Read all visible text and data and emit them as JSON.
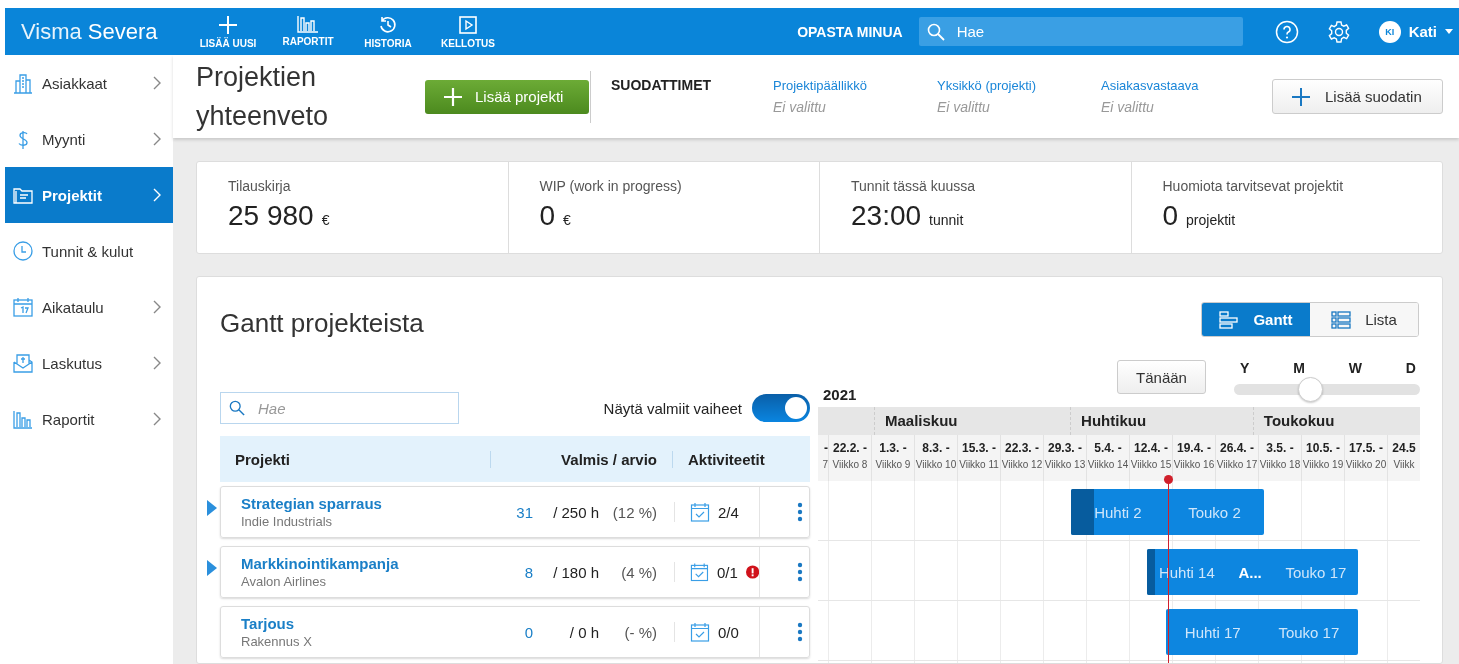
{
  "logo": {
    "light": "Visma",
    "bold": "Severa"
  },
  "topnav": [
    {
      "label": "LISÄÄ UUSI",
      "kind": "add"
    },
    {
      "label": "RAPORTIT",
      "kind": "reports"
    },
    {
      "label": "HISTORIA",
      "kind": "history"
    },
    {
      "label": "KELLOTUS",
      "kind": "timer"
    }
  ],
  "guide": "OPASTA MINUA",
  "search": {
    "placeholder": "Hae"
  },
  "user": {
    "initials": "KI",
    "name": "Kati"
  },
  "sidebar": {
    "items": [
      {
        "label": "Asiakkaat",
        "kind": "customers",
        "selected": false,
        "submenu": true
      },
      {
        "label": "Myynti",
        "kind": "sales",
        "selected": false,
        "submenu": true
      },
      {
        "label": "Projektit",
        "kind": "projects",
        "selected": true,
        "submenu": true
      },
      {
        "label": "Tunnit & kulut",
        "kind": "hours",
        "selected": false,
        "submenu": false
      },
      {
        "label": "Aikataulu",
        "kind": "schedule",
        "selected": false,
        "submenu": true
      },
      {
        "label": "Laskutus",
        "kind": "billing",
        "selected": false,
        "submenu": true
      },
      {
        "label": "Raportit",
        "kind": "reports",
        "selected": false,
        "submenu": true
      }
    ]
  },
  "page_title": "Projektien yhteenveto",
  "add_project": "Lisää projekti",
  "filters": {
    "title": "SUODATTIMET",
    "items": [
      {
        "label": "Projektipäällikkö",
        "value": "Ei valittu"
      },
      {
        "label": "Yksikkö (projekti)",
        "value": "Ei valittu"
      },
      {
        "label": "Asiakasvastaava",
        "value": "Ei valittu"
      }
    ],
    "add_button": "Lisää suodatin"
  },
  "summary": [
    {
      "label": "Tilauskirja",
      "value": "25 980",
      "unit": "€"
    },
    {
      "label": "WIP (work in progress)",
      "value": "0",
      "unit": "€"
    },
    {
      "label": "Tunnit tässä kuussa",
      "value": "23:00",
      "unit": "tunnit"
    },
    {
      "label": "Huomiota tarvitsevat projektit",
      "value": "0",
      "unit": "projektit"
    }
  ],
  "gantt": {
    "title": "Gantt projekteista",
    "views": [
      {
        "label": "Gantt",
        "kind": "gantt",
        "selected": true
      },
      {
        "label": "Lista",
        "kind": "list",
        "selected": false
      }
    ],
    "today_button": "Tänään",
    "zoom": {
      "labels": [
        "Y",
        "M",
        "W",
        "D"
      ],
      "level": 0.4
    },
    "search": {
      "placeholder": "Hae"
    },
    "show_completed": {
      "label": "Näytä valmiit vaiheet",
      "on": true
    },
    "columns": [
      "Projekti",
      "Valmis / arvio",
      "Aktiviteetit"
    ],
    "rows": [
      {
        "name": "Strategian sparraus",
        "customer": "Indie Industrials",
        "done": "31",
        "estimate": "/ 250 h",
        "percent": "(12 %)",
        "activities": "2/4",
        "alert": false,
        "expandable": true
      },
      {
        "name": "Markkinointikampanja",
        "customer": "Avalon Airlines",
        "done": "8",
        "estimate": "/ 180 h",
        "percent": "(4 %)",
        "activities": "0/1",
        "alert": true,
        "expandable": true
      },
      {
        "name": "Tarjous",
        "customer": "Rakennus X",
        "done": "0",
        "estimate": "/ 0 h",
        "percent": "(- %)",
        "activities": "0/0",
        "alert": false,
        "expandable": false
      }
    ],
    "timeline": {
      "year": "2021",
      "months": [
        "Maaliskuu",
        "Huhtikuu",
        "Toukokuu"
      ],
      "weeks": [
        {
          "date": "-",
          "week": "7"
        },
        {
          "date": "22.2. -",
          "week": "Viikko 8"
        },
        {
          "date": "1.3. -",
          "week": "Viikko 9"
        },
        {
          "date": "8.3. -",
          "week": "Viikko 10"
        },
        {
          "date": "15.3. -",
          "week": "Viikko 11"
        },
        {
          "date": "22.3. -",
          "week": "Viikko 12"
        },
        {
          "date": "29.3. -",
          "week": "Viikko 13"
        },
        {
          "date": "5.4. -",
          "week": "Viikko 14"
        },
        {
          "date": "12.4. -",
          "week": "Viikko 15"
        },
        {
          "date": "19.4. -",
          "week": "Viikko 16"
        },
        {
          "date": "26.4. -",
          "week": "Viikko 17"
        },
        {
          "date": "3.5. -",
          "week": "Viikko 18"
        },
        {
          "date": "10.5. -",
          "week": "Viikko 19"
        },
        {
          "date": "17.5. -",
          "week": "Viikko 20"
        },
        {
          "date": "24.5",
          "week": "Viikk"
        }
      ],
      "bars": [
        {
          "start": "Huhti 2",
          "end": "Touko 2",
          "level": 0.12
        },
        {
          "start": "Huhti 14",
          "name": "A...",
          "end": "Touko 17",
          "level": 0.04
        },
        {
          "start": "Huhti 17",
          "end": "Touko 17"
        }
      ]
    }
  }
}
